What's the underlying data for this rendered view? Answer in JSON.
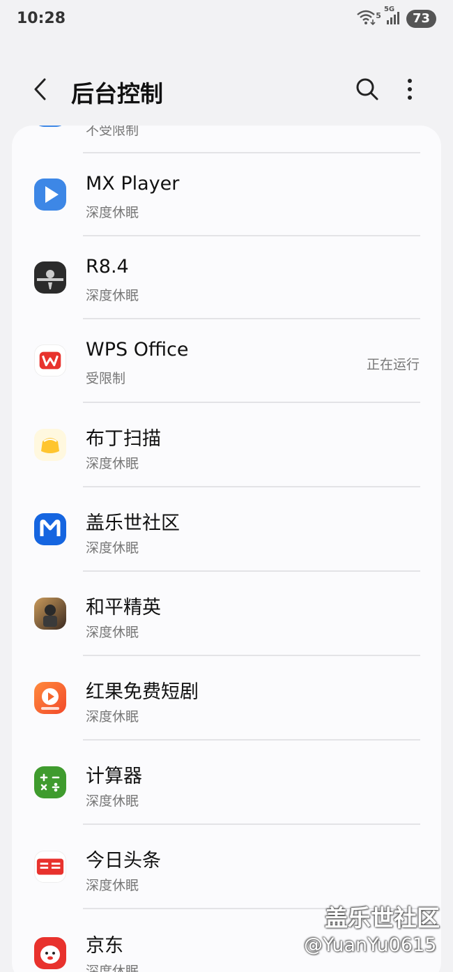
{
  "status_bar": {
    "time": "10:28",
    "network": "5G",
    "wifi_sub": "5",
    "battery": "73"
  },
  "header": {
    "title": "后台控制"
  },
  "partial_row": {
    "sub": "不受限制"
  },
  "apps": [
    {
      "name": "MX Player",
      "sub": "深度休眠",
      "status": "",
      "icon": "mx-player-icon",
      "color": "#3d87e6"
    },
    {
      "name": "R8.4",
      "sub": "深度休眠",
      "status": "",
      "icon": "rock-power-icon",
      "color": "#2b2b2b"
    },
    {
      "name": "WPS Office",
      "sub": "受限制",
      "status": "正在运行",
      "icon": "wps-office-icon",
      "color": "#e8322d"
    },
    {
      "name": "布丁扫描",
      "sub": "深度休眠",
      "status": "",
      "icon": "pudding-scan-icon",
      "color": "#ffcc33"
    },
    {
      "name": "盖乐世社区",
      "sub": "深度休眠",
      "status": "",
      "icon": "galaxy-community-icon",
      "color": "#1565e0"
    },
    {
      "name": "和平精英",
      "sub": "深度休眠",
      "status": "",
      "icon": "peace-elite-icon",
      "color": "#6b4a32"
    },
    {
      "name": "红果免费短剧",
      "sub": "深度休眠",
      "status": "",
      "icon": "hongguo-drama-icon",
      "color": "#f5672d"
    },
    {
      "name": "计算器",
      "sub": "深度休眠",
      "status": "",
      "icon": "calculator-icon",
      "color": "#3f9b2e"
    },
    {
      "name": "今日头条",
      "sub": "深度休眠",
      "status": "",
      "icon": "toutiao-icon",
      "color": "#e8322d"
    },
    {
      "name": "京东",
      "sub": "深度休眠",
      "status": "",
      "icon": "jd-icon",
      "color": "#e8322d"
    }
  ],
  "watermark": {
    "line1": "盖乐世社区",
    "line2": "@YuanYu0615"
  }
}
